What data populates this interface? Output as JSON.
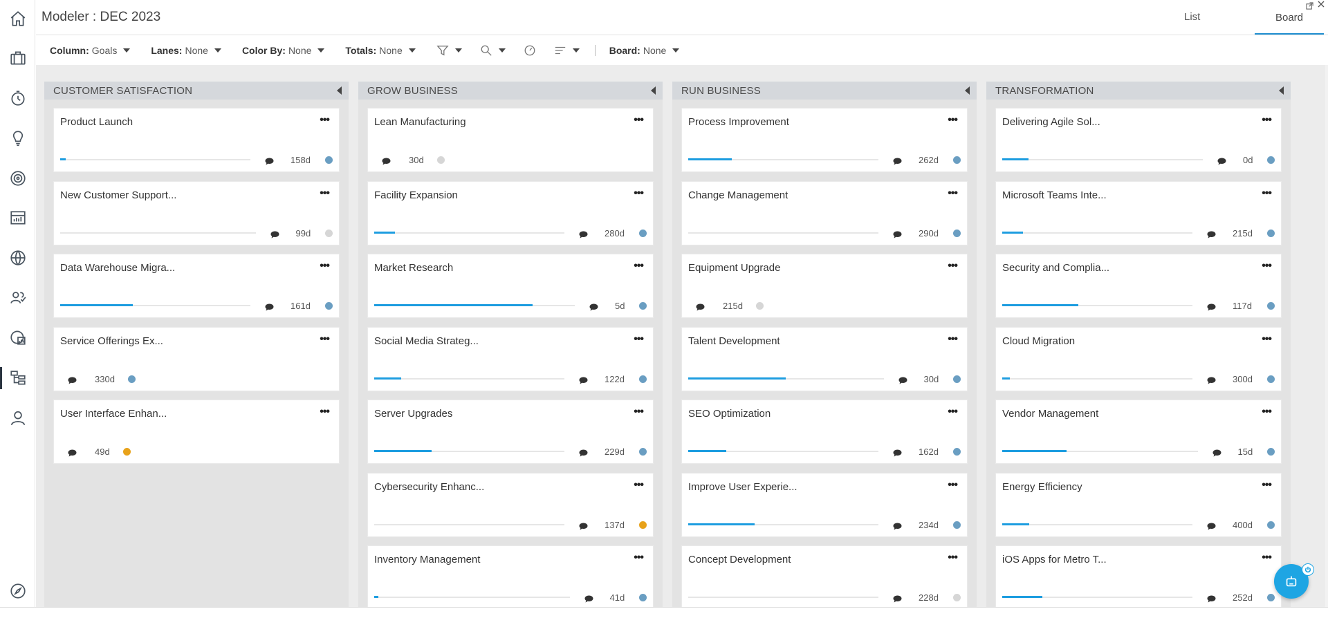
{
  "header": {
    "title": "Modeler : DEC 2023",
    "tabs": [
      {
        "label": "List"
      },
      {
        "label": "Board"
      }
    ],
    "active_tab": "Board"
  },
  "rail": [
    {
      "icon": "home-icon"
    },
    {
      "icon": "briefcase-icon"
    },
    {
      "icon": "timer-icon"
    },
    {
      "icon": "lightbulb-icon"
    },
    {
      "icon": "target-icon"
    },
    {
      "icon": "chart-icon"
    },
    {
      "icon": "globe-icon"
    },
    {
      "icon": "people-icon"
    },
    {
      "icon": "report-icon"
    },
    {
      "icon": "hierarchy-icon",
      "active": true
    },
    {
      "icon": "user-icon"
    },
    {
      "icon": "compass-icon"
    }
  ],
  "toolbar": {
    "column_label": "Column:",
    "column_value": "Goals",
    "lanes_label": "Lanes:",
    "lanes_value": "None",
    "colorby_label": "Color By:",
    "colorby_value": "None",
    "totals_label": "Totals:",
    "totals_value": "None",
    "board_label": "Board:",
    "board_value": "None"
  },
  "colors": {
    "accent": "#1d9de0",
    "dot_blue": "#6a9ec2",
    "dot_gray": "#d6d6d6",
    "dot_orange": "#e8a21a"
  },
  "columns": [
    {
      "title": "CUSTOMER SATISFACTION",
      "cards": [
        {
          "title": "Product Launch",
          "days": "158d",
          "progress": 0.03,
          "dot": "blue"
        },
        {
          "title": "New Customer Support...",
          "days": "99d",
          "progress": 0.0,
          "dot": "gray"
        },
        {
          "title": "Data Warehouse Migra...",
          "days": "161d",
          "progress": 0.38,
          "dot": "blue"
        },
        {
          "title": "Service Offerings Ex...",
          "days": "330d",
          "progress": null,
          "dot": "blue"
        },
        {
          "title": "User Interface Enhan...",
          "days": "49d",
          "progress": null,
          "dot": "orange"
        }
      ]
    },
    {
      "title": "GROW BUSINESS",
      "cards": [
        {
          "title": "Lean Manufacturing",
          "days": "30d",
          "progress": null,
          "dot": "gray"
        },
        {
          "title": "Facility Expansion",
          "days": "280d",
          "progress": 0.11,
          "dot": "blue"
        },
        {
          "title": "Market Research",
          "days": "5d",
          "progress": 0.79,
          "dot": "blue"
        },
        {
          "title": "Social Media Strateg...",
          "days": "122d",
          "progress": 0.14,
          "dot": "blue"
        },
        {
          "title": "Server Upgrades",
          "days": "229d",
          "progress": 0.3,
          "dot": "blue"
        },
        {
          "title": "Cybersecurity Enhanc...",
          "days": "137d",
          "progress": 0.0,
          "dot": "orange"
        },
        {
          "title": "Inventory Management",
          "days": "41d",
          "progress": 0.02,
          "dot": "blue"
        }
      ]
    },
    {
      "title": "RUN BUSINESS",
      "cards": [
        {
          "title": "Process Improvement",
          "days": "262d",
          "progress": 0.23,
          "dot": "blue"
        },
        {
          "title": "Change Management",
          "days": "290d",
          "progress": 0.0,
          "dot": "blue"
        },
        {
          "title": "Equipment Upgrade",
          "days": "215d",
          "progress": null,
          "dot": "gray"
        },
        {
          "title": "Talent Development",
          "days": "30d",
          "progress": 0.5,
          "dot": "blue"
        },
        {
          "title": "SEO Optimization",
          "days": "162d",
          "progress": 0.2,
          "dot": "blue"
        },
        {
          "title": "Improve User Experie...",
          "days": "234d",
          "progress": 0.35,
          "dot": "blue"
        },
        {
          "title": "Concept Development",
          "days": "228d",
          "progress": 0.0,
          "dot": "gray"
        }
      ]
    },
    {
      "title": "TRANSFORMATION",
      "cards": [
        {
          "title": "Delivering Agile Sol...",
          "days": "0d",
          "progress": 0.13,
          "dot": "blue"
        },
        {
          "title": "Microsoft Teams Inte...",
          "days": "215d",
          "progress": 0.11,
          "dot": "blue"
        },
        {
          "title": "Security and Complia...",
          "days": "117d",
          "progress": 0.4,
          "dot": "blue"
        },
        {
          "title": "Cloud Migration",
          "days": "300d",
          "progress": 0.04,
          "dot": "blue"
        },
        {
          "title": "Vendor Management",
          "days": "15d",
          "progress": 0.33,
          "dot": "blue"
        },
        {
          "title": "Energy Efficiency",
          "days": "400d",
          "progress": 0.14,
          "dot": "blue"
        },
        {
          "title": "iOS Apps for Metro T...",
          "days": "252d",
          "progress": 0.21,
          "dot": "blue"
        }
      ]
    }
  ]
}
